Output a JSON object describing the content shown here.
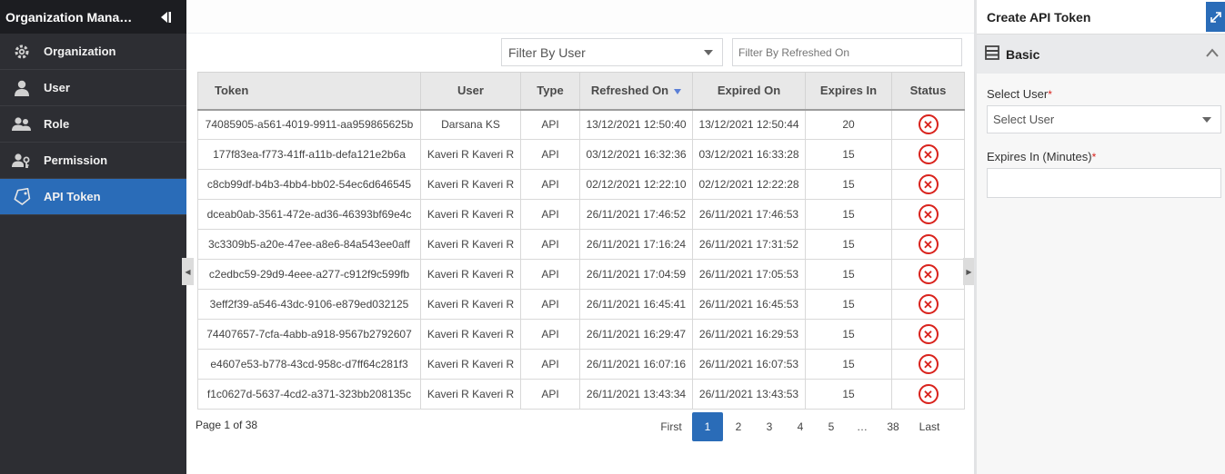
{
  "sidebar": {
    "title": "Organization Mana…",
    "collapse_icon": "collapse-left-icon",
    "items": [
      {
        "label": "Organization",
        "icon": "gear-icon"
      },
      {
        "label": "User",
        "icon": "user-icon"
      },
      {
        "label": "Role",
        "icon": "users-icon"
      },
      {
        "label": "Permission",
        "icon": "key-user-icon"
      },
      {
        "label": "API Token",
        "icon": "tag-icon",
        "active": true
      }
    ]
  },
  "filters": {
    "user_placeholder": "Filter By User",
    "refreshed_placeholder": "Filter By Refreshed On"
  },
  "table": {
    "headers": {
      "token": "Token",
      "user": "User",
      "type": "Type",
      "refreshed_on": "Refreshed On",
      "expired_on": "Expired On",
      "expires_in": "Expires In",
      "status": "Status"
    },
    "sort": {
      "column": "Refreshed On",
      "direction": "descending"
    },
    "rows": [
      {
        "token": "74085905-a561-4019-9911-aa959865625b",
        "user": "Darsana KS",
        "type": "API",
        "refreshed_on": "13/12/2021 12:50:40",
        "expired_on": "13/12/2021 12:50:44",
        "expires_in": "20",
        "status_icon": "error-x-icon"
      },
      {
        "token": "177f83ea-f773-41ff-a11b-defa121e2b6a",
        "user": "Kaveri R Kaveri R",
        "type": "API",
        "refreshed_on": "03/12/2021 16:32:36",
        "expired_on": "03/12/2021 16:33:28",
        "expires_in": "15",
        "status_icon": "error-x-icon"
      },
      {
        "token": "c8cb99df-b4b3-4bb4-bb02-54ec6d646545",
        "user": "Kaveri R Kaveri R",
        "type": "API",
        "refreshed_on": "02/12/2021 12:22:10",
        "expired_on": "02/12/2021 12:22:28",
        "expires_in": "15",
        "status_icon": "error-x-icon"
      },
      {
        "token": "dceab0ab-3561-472e-ad36-46393bf69e4c",
        "user": "Kaveri R Kaveri R",
        "type": "API",
        "refreshed_on": "26/11/2021 17:46:52",
        "expired_on": "26/11/2021 17:46:53",
        "expires_in": "15",
        "status_icon": "error-x-icon"
      },
      {
        "token": "3c3309b5-a20e-47ee-a8e6-84a543ee0aff",
        "user": "Kaveri R Kaveri R",
        "type": "API",
        "refreshed_on": "26/11/2021 17:16:24",
        "expired_on": "26/11/2021 17:31:52",
        "expires_in": "15",
        "status_icon": "error-x-icon"
      },
      {
        "token": "c2edbc59-29d9-4eee-a277-c912f9c599fb",
        "user": "Kaveri R Kaveri R",
        "type": "API",
        "refreshed_on": "26/11/2021 17:04:59",
        "expired_on": "26/11/2021 17:05:53",
        "expires_in": "15",
        "status_icon": "error-x-icon"
      },
      {
        "token": "3eff2f39-a546-43dc-9106-e879ed032125",
        "user": "Kaveri R Kaveri R",
        "type": "API",
        "refreshed_on": "26/11/2021 16:45:41",
        "expired_on": "26/11/2021 16:45:53",
        "expires_in": "15",
        "status_icon": "error-x-icon"
      },
      {
        "token": "74407657-7cfa-4abb-a918-9567b2792607",
        "user": "Kaveri R Kaveri R",
        "type": "API",
        "refreshed_on": "26/11/2021 16:29:47",
        "expired_on": "26/11/2021 16:29:53",
        "expires_in": "15",
        "status_icon": "error-x-icon"
      },
      {
        "token": "e4607e53-b778-43cd-958c-d7ff64c281f3",
        "user": "Kaveri R Kaveri R",
        "type": "API",
        "refreshed_on": "26/11/2021 16:07:16",
        "expired_on": "26/11/2021 16:07:53",
        "expires_in": "15",
        "status_icon": "error-x-icon"
      },
      {
        "token": "f1c0627d-5637-4cd2-a371-323bb208135c",
        "user": "Kaveri R Kaveri R",
        "type": "API",
        "refreshed_on": "26/11/2021 13:43:34",
        "expired_on": "26/11/2021 13:43:53",
        "expires_in": "15",
        "status_icon": "error-x-icon"
      }
    ]
  },
  "pagination": {
    "info": "Page 1 of 38",
    "first": "First",
    "pages": [
      "1",
      "2",
      "3",
      "4",
      "5",
      "…",
      "38"
    ],
    "current": "1",
    "last": "Last"
  },
  "panel": {
    "title": "Create API Token",
    "expand_icon": "expand-icon",
    "section": {
      "title": "Basic",
      "icon": "form-section-icon",
      "toggle_icon": "chevron-up-icon"
    },
    "select_user": {
      "label": "Select User",
      "required_mark": "*",
      "placeholder": "Select User"
    },
    "expires_in": {
      "label": "Expires In (Minutes)",
      "required_mark": "*",
      "value": ""
    }
  },
  "colors": {
    "sidebar_bg": "#2d2e33",
    "sidebar_header_bg": "#1c1d21",
    "accent": "#2a6cb8",
    "error": "#d9221c"
  }
}
